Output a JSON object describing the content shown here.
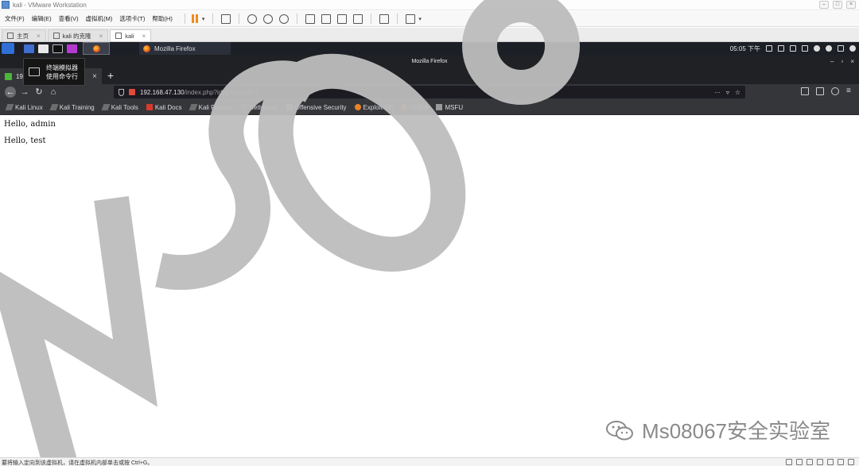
{
  "vmware": {
    "title": "kali - VMware Workstation",
    "menu": [
      "文件(F)",
      "编辑(E)",
      "查看(V)",
      "虚拟机(M)",
      "选项卡(T)",
      "帮助(H)"
    ],
    "tabs": [
      {
        "label": "主页"
      },
      {
        "label": "kali 的克隆"
      },
      {
        "label": "kali"
      }
    ],
    "status_message": "要将输入定向到该虚拟机，请在虚拟机内部单击或按 Ctrl+G。"
  },
  "kali": {
    "taskbar_window": "Mozilla Firefox",
    "clock": "05:05 下午",
    "tooltip_line1": "终端模拟器",
    "tooltip_line2": "使用命令行"
  },
  "firefox": {
    "window_title": "Mozilla Firefox",
    "tab_label": "19",
    "url_host": "192.168.47.130",
    "url_path": "/index.php?ids[]=1&ids[]=2",
    "bookmarks": [
      {
        "label": "Kali Linux"
      },
      {
        "label": "Kali Training"
      },
      {
        "label": "Kali Tools"
      },
      {
        "label": "Kali Docs"
      },
      {
        "label": "Kali Forums"
      },
      {
        "label": "NetHunter"
      },
      {
        "label": "Offensive Security"
      },
      {
        "label": "Exploit-DB"
      },
      {
        "label": "GHDB"
      },
      {
        "label": "MSFU"
      }
    ]
  },
  "page": {
    "lines": [
      "Hello, admin",
      "Hello, test"
    ]
  },
  "watermark": {
    "text": "Ms08067安全实验室"
  },
  "colors": {
    "kali_panel": "#1c1f26",
    "firefox_toolbar": "#35363a",
    "vm_pause": "#f08c1a",
    "watermark": "#bdbdbd"
  }
}
